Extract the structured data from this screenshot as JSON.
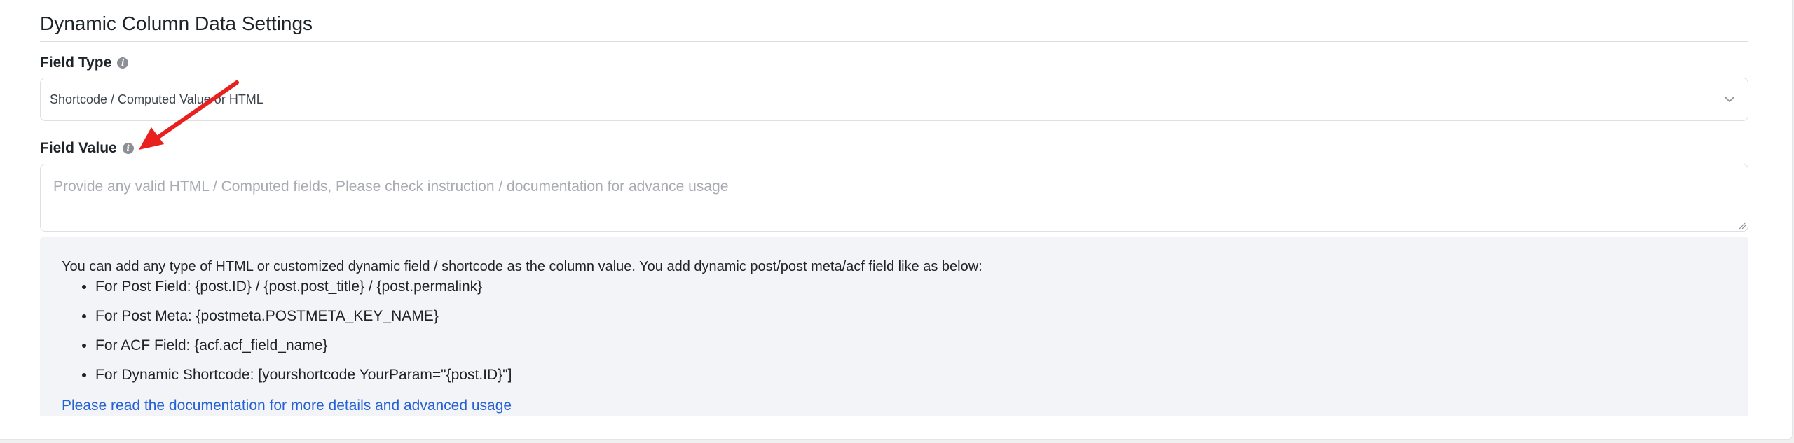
{
  "section": {
    "title": "Dynamic Column Data Settings"
  },
  "field_type": {
    "label": "Field Type",
    "info_icon": "info-icon",
    "selected_value": "Shortcode / Computed Value or HTML",
    "dropdown_icon": "chevron-down-icon"
  },
  "field_value": {
    "label": "Field Value",
    "info_icon": "info-icon",
    "placeholder": "Provide any valid HTML / Computed fields, Please check instruction / documentation for advance usage"
  },
  "help": {
    "intro": "You can add any type of HTML or customized dynamic field / shortcode as the column value. You add dynamic post/post meta/acf field like as below:",
    "items": [
      "For Post Field: {post.ID} / {post.post_title} / {post.permalink}",
      "For Post Meta: {postmeta.POSTMETA_KEY_NAME}",
      "For ACF Field: {acf.acf_field_name}",
      "For Dynamic Shortcode: [yourshortcode YourParam=\"{post.ID}\"]"
    ],
    "link_text": "Please read the documentation for more details and advanced usage"
  },
  "annotation": {
    "arrow_color": "#e8201e",
    "icon": "red-arrow-icon"
  },
  "colors": {
    "link": "#2460d6",
    "placeholder": "#a8abb2",
    "help_background": "#f3f4f8"
  }
}
